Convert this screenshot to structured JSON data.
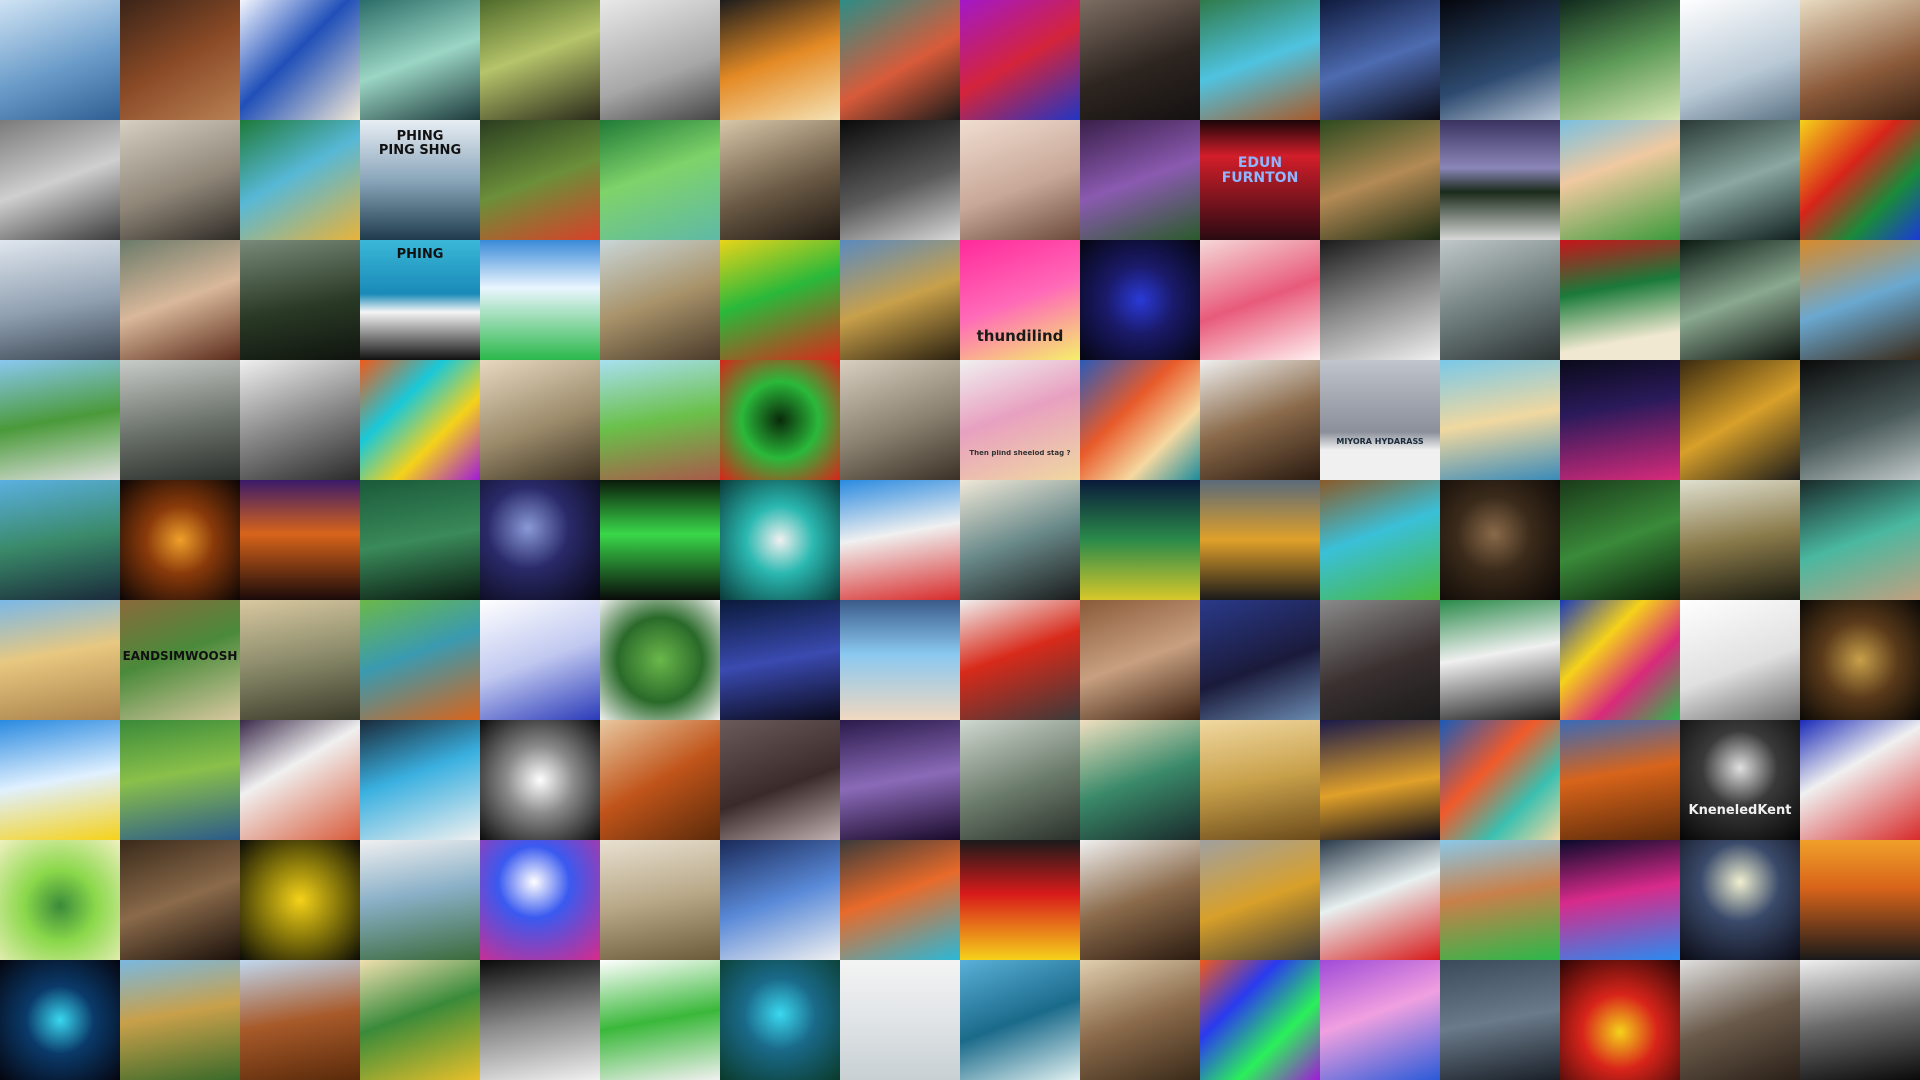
{
  "mosaic": {
    "tiles": [
      {
        "name": "tile-ice-figure",
        "bg": "linear-gradient(160deg,#cfe3f4 0%,#6b9cc9 55%,#2f5f93 100%)"
      },
      {
        "name": "tile-cello-forest",
        "bg": "linear-gradient(150deg,#3b2418 0%,#8a4a26 50%,#b98054 100%)"
      },
      {
        "name": "tile-wave-binoculars",
        "bg": "linear-gradient(135deg,#f3f6ff 0%,#1f4fb8 45%,#f2e9d6 100%)"
      },
      {
        "name": "tile-robot-city",
        "bg": "linear-gradient(160deg,#2b6d68 0%,#9bd6c4 50%,#1d3a3b 100%)"
      },
      {
        "name": "tile-man-forest",
        "bg": "linear-gradient(160deg,#4e6a2a 0%,#b6c46a 45%,#2a2a1a 100%)"
      },
      {
        "name": "tile-sink-drain",
        "bg": "linear-gradient(160deg,#e9e9e9 0%,#a7a7a7 60%,#444 100%)"
      },
      {
        "name": "tile-volcano-glasses",
        "bg": "linear-gradient(160deg,#1c1c1c 0%,#e48a25 50%,#f4e1b3 100%)"
      },
      {
        "name": "tile-dragon-mural",
        "bg": "linear-gradient(150deg,#2c8d86 0%,#d85b3a 55%,#1a1a1a 100%)"
      },
      {
        "name": "tile-vampire-neon",
        "bg": "linear-gradient(150deg,#a218c9 0%,#d4243b 50%,#2135c3 100%)"
      },
      {
        "name": "tile-woman-portrait",
        "bg": "linear-gradient(160deg,#7d6d62 0%,#2d2520 55%,#151111 100%)"
      },
      {
        "name": "tile-waterfall-boat",
        "bg": "linear-gradient(160deg,#2f7a4a 0%,#4fc3e0 50%,#a85a2a 100%)"
      },
      {
        "name": "tile-werewolf-city",
        "bg": "linear-gradient(160deg,#0f1a3d 0%,#4d6bb0 50%,#0a0a14 100%)"
      },
      {
        "name": "tile-satellite-earth",
        "bg": "linear-gradient(160deg,#05060d 0%,#2d4a6f 60%,#b8c6d6 100%)"
      },
      {
        "name": "tile-forest-path",
        "bg": "linear-gradient(160deg,#10291c 0%,#5d9a57 50%,#d7e6b3 100%)"
      },
      {
        "name": "tile-telescope-white",
        "bg": "linear-gradient(160deg,#ffffff 0%,#b9c9d6 60%,#5b7385 100%)"
      },
      {
        "name": "tile-scissors-desert",
        "bg": "linear-gradient(160deg,#e9dcc2 0%,#8b5a3a 60%,#3b2315 100%)"
      },
      {
        "name": "tile-snow-sculpture",
        "bg": "linear-gradient(160deg,#7a7a7a 0%,#cfcfcf 50%,#3b3b3b 100%)"
      },
      {
        "name": "tile-deer-sepia",
        "bg": "linear-gradient(160deg,#d6cfc2 0%,#8f8678 55%,#2e2a25 100%)"
      },
      {
        "name": "tile-irish-man",
        "bg": "linear-gradient(150deg,#1e7a3a 0%,#57b8d6 45%,#e8b33a 100%)"
      },
      {
        "name": "tile-ping-pong",
        "bg": "linear-gradient(180deg,#e8eef4 0%,#8aa6ba 50%,#1f3b4d 100%)",
        "caption": "PHING\nPING SHNG",
        "capColor": "#111",
        "capTop": 10,
        "capSize": 13
      },
      {
        "name": "tile-origami-tripod",
        "bg": "linear-gradient(160deg,#2a3d20 0%,#6b8f3a 50%,#d8412a 100%)"
      },
      {
        "name": "tile-green-statue",
        "bg": "linear-gradient(160deg,#1f7a36 0%,#7fd36a 45%,#5fb9a6 100%)"
      },
      {
        "name": "tile-sepia-warrior",
        "bg": "linear-gradient(160deg,#d8c7a8 0%,#6b5a45 55%,#1e1812 100%)"
      },
      {
        "name": "tile-chess-tree",
        "bg": "linear-gradient(160deg,#0a0a0a 0%,#5a5a5a 55%,#d9d9d9 100%)"
      },
      {
        "name": "tile-skateboard",
        "bg": "linear-gradient(160deg,#f0ddd0 0%,#c8a898 55%,#6b4a3a 100%)"
      },
      {
        "name": "tile-fairy-forest",
        "bg": "linear-gradient(160deg,#3a1f4a 0%,#8a5ab0 50%,#2a5a2a 100%)"
      },
      {
        "name": "tile-edun-furnton",
        "bg": "linear-gradient(180deg,#1a0508 0%,#d21e2a 30%,#2a0a12 100%)",
        "caption": "EDUN\nFURNTON",
        "capColor": "#8fb6ff",
        "capTop": 36,
        "capSize": 14
      },
      {
        "name": "tile-couple-jungle",
        "bg": "linear-gradient(160deg,#2d4a1f 0%,#b38a55 50%,#1a2a12 100%)"
      },
      {
        "name": "tile-checker-lake",
        "bg": "linear-gradient(180deg,#3a3360 0%,#8b86b8 40%,#1a2a1a 60%,#d8d8d8 100%)"
      },
      {
        "name": "tile-green-figure",
        "bg": "linear-gradient(160deg,#7ac0e0 0%,#f0c9a0 40%,#3a9a3a 100%)"
      },
      {
        "name": "tile-stone-hall",
        "bg": "linear-gradient(160deg,#2a3a36 0%,#8aa7a0 50%,#10201e 100%)"
      },
      {
        "name": "tile-graffiti-cross",
        "bg": "linear-gradient(135deg,#f5d21a 0%,#d8241a 40%,#1a8a3a 70%,#1a3ad8 100%)"
      },
      {
        "name": "tile-sky-clouds",
        "bg": "linear-gradient(170deg,#dfe6ee 0%,#8f9fb0 55%,#3a4652 100%)"
      },
      {
        "name": "tile-woman-profile",
        "bg": "linear-gradient(160deg,#6b7a6a 0%,#d9b89a 50%,#5a2a1a 100%)"
      },
      {
        "name": "tile-dark-forest",
        "bg": "linear-gradient(170deg,#7a8a7a 0%,#2a3a26 55%,#0f140e 100%)"
      },
      {
        "name": "tile-phing-board",
        "bg": "linear-gradient(180deg,#3ab8d8 0%,#1a8ab8 45%,#f5f5f5 60%,#111 100%)",
        "caption": "PHING",
        "capColor": "#111",
        "capTop": 8,
        "capSize": 13
      },
      {
        "name": "tile-gamepad",
        "bg": "linear-gradient(180deg,#3a8ad8 0%,#eaf6ff 40%,#2ab84a 100%)"
      },
      {
        "name": "tile-dry-grass",
        "bg": "linear-gradient(160deg,#c9d6d8 0%,#a8936a 50%,#4a3a2a 100%)"
      },
      {
        "name": "tile-flower-field",
        "bg": "linear-gradient(160deg,#e8d41a 0%,#2ab83a 45%,#d82a1a 100%)"
      },
      {
        "name": "tile-gold-sculpture",
        "bg": "linear-gradient(160deg,#5a8ac0 0%,#c8a04a 50%,#2a2010 100%)"
      },
      {
        "name": "tile-thundilind",
        "bg": "linear-gradient(160deg,#ff2a9a 0%,#ff6ab8 50%,#f5f06a 100%)",
        "caption": "thundilind",
        "capColor": "#1a1a1a",
        "capTop": 88,
        "capSize": 15
      },
      {
        "name": "tile-blue-vase",
        "bg": "radial-gradient(circle at 50% 50%,#2a3ad8 0%,#1a1a6a 40%,#050510 100%)"
      },
      {
        "name": "tile-geisha",
        "bg": "linear-gradient(160deg,#f5d8d8 0%,#e85a7a 50%,#fff0f0 100%)"
      },
      {
        "name": "tile-guitar",
        "bg": "linear-gradient(160deg,#1a1a1a 0%,#8a8a8a 50%,#f0f0f0 100%)"
      },
      {
        "name": "tile-waterfall-man",
        "bg": "linear-gradient(160deg,#c0c8c8 0%,#6a7878 55%,#2a3030 100%)"
      },
      {
        "name": "tile-green-poster",
        "bg": "linear-gradient(170deg,#c8141a 0%,#1a7a3a 40%,#f0e8d0 80%)"
      },
      {
        "name": "tile-dark-columns",
        "bg": "linear-gradient(160deg,#0a1a12 0%,#8aa890 50%,#0a0f0a 100%)"
      },
      {
        "name": "tile-gold-face",
        "bg": "linear-gradient(160deg,#d88a2a 0%,#6aa8d0 50%,#3a2a1a 100%)"
      },
      {
        "name": "tile-robot-road",
        "bg": "linear-gradient(170deg,#8ac8f0 0%,#4a9a3a 50%,#e0e0e0 100%)"
      },
      {
        "name": "tile-foggy-trees",
        "bg": "linear-gradient(170deg,#c8ccc8 0%,#6a706a 55%,#2a2e2a 100%)"
      },
      {
        "name": "tile-sand-climber",
        "bg": "linear-gradient(160deg,#f0f0f0 0%,#8a8a8a 50%,#2a2a2a 100%)"
      },
      {
        "name": "tile-roller-blocks",
        "bg": "linear-gradient(135deg,#f05a1a 0%,#1ac8d8 35%,#f5d21a 65%,#a01ad8 100%)"
      },
      {
        "name": "tile-sepia-man",
        "bg": "linear-gradient(160deg,#e8d8c0 0%,#9a8a6a 55%,#3a3020 100%)"
      },
      {
        "name": "tile-floating-island",
        "bg": "linear-gradient(170deg,#a8e0f0 0%,#6ac04a 50%,#a85a4a 100%)"
      },
      {
        "name": "tile-clock-plants",
        "bg": "radial-gradient(circle at 50% 50%,#0a2a0a 0%,#2ab83a 45%,#d8241a 100%)"
      },
      {
        "name": "tile-smoke-face",
        "bg": "linear-gradient(160deg,#d8cfc0 0%,#8a8070 55%,#3a3025 100%)"
      },
      {
        "name": "tile-polaroid",
        "bg": "linear-gradient(160deg,#f0f0f0 0%,#e8a0c0 45%,#f0d8a0 100%)",
        "caption": "Then plind sheelod stag ?",
        "capColor": "#333",
        "capTop": 90,
        "capSize": 7
      },
      {
        "name": "tile-dragon-pattern",
        "bg": "linear-gradient(135deg,#2a5ab8 0%,#e85a2a 40%,#f5d8a0 70%,#1a8a9a 100%)"
      },
      {
        "name": "tile-man-hat",
        "bg": "linear-gradient(160deg,#f0f0f0 0%,#8a6a4a 50%,#2a1a10 100%)"
      },
      {
        "name": "tile-miyora-hydarass",
        "bg": "linear-gradient(180deg,#c0c4cc 0%,#8a8f9a 60%,#f0f0f0 75%,#f0f0f0 100%)",
        "caption": "MIYORA HYDARASS",
        "capColor": "#1a2a3a",
        "capTop": 78,
        "capSize": 8
      },
      {
        "name": "tile-beach-robot",
        "bg": "linear-gradient(170deg,#7ac8e8 0%,#f0d8a0 50%,#3a8ab8 100%)"
      },
      {
        "name": "tile-neon-books",
        "bg": "linear-gradient(170deg,#0a0a1a 0%,#2a1a5a 40%,#d82a7a 100%)"
      },
      {
        "name": "tile-gold-bird",
        "bg": "linear-gradient(150deg,#3a2a10 0%,#d8a02a 50%,#1a1a1a 100%)"
      },
      {
        "name": "tile-dark-reader",
        "bg": "linear-gradient(160deg,#0a0a0a 0%,#4a5a5a 55%,#c0c8c8 100%)"
      },
      {
        "name": "tile-telescope-lake",
        "bg": "linear-gradient(170deg,#5ab0e0 0%,#3a8a6a 50%,#1a2a3a 100%)"
      },
      {
        "name": "tile-fire-dancer",
        "bg": "radial-gradient(circle at 50% 50%,#f0a02a 0%,#8a3a0a 40%,#0a0505 100%)"
      },
      {
        "name": "tile-sunset-field",
        "bg": "linear-gradient(180deg,#3a1a6a 0%,#d8641a 45%,#1a0a0a 100%)"
      },
      {
        "name": "tile-roller-skate",
        "bg": "linear-gradient(170deg,#1a5a3a 0%,#3a8a5a 50%,#0a1a10 100%)"
      },
      {
        "name": "tile-galaxy",
        "bg": "radial-gradient(circle at 40% 40%,#8a9ad8 0%,#2a2a6a 40%,#05050f 100%)"
      },
      {
        "name": "tile-piano-light",
        "bg": "linear-gradient(180deg,#0a1a0a 0%,#3ad84a 45%,#0a0a0a 100%)"
      },
      {
        "name": "tile-fan-wave",
        "bg": "radial-gradient(circle at 50% 50%,#f0f0f0 0%,#2ab8b0 40%,#0a3a3a 100%)"
      },
      {
        "name": "tile-graffiti-tower",
        "bg": "linear-gradient(170deg,#2a8ae0 0%,#f0f0f0 45%,#d82a2a 100%)"
      },
      {
        "name": "tile-thinker-art",
        "bg": "linear-gradient(160deg,#f0e8d8 0%,#6a8a8a 50%,#1a1a1a 100%)"
      },
      {
        "name": "tile-neon-forest",
        "bg": "linear-gradient(180deg,#0a1a3a 0%,#2a8a4a 50%,#d8c82a 100%)"
      },
      {
        "name": "tile-city-clock",
        "bg": "linear-gradient(180deg,#5a6a7a 0%,#e0a02a 50%,#1a1a1a 100%)"
      },
      {
        "name": "tile-pixel-map",
        "bg": "linear-gradient(160deg,#8a5a2a 0%,#3ac0d8 45%,#4ab83a 100%)"
      },
      {
        "name": "tile-dark-cave",
        "bg": "radial-gradient(circle at 45% 45%,#8a6a4a 0%,#3a2a1a 40%,#0a0605 100%)"
      },
      {
        "name": "tile-green-demon",
        "bg": "linear-gradient(160deg,#1a3a1a 0%,#3a8a3a 50%,#0a1a0a 100%)"
      },
      {
        "name": "tile-pixel-tower",
        "bg": "linear-gradient(170deg,#e0e0d0 0%,#8a7a4a 50%,#1a1a10 100%)"
      },
      {
        "name": "tile-green-creature",
        "bg": "linear-gradient(160deg,#1a2a2a 0%,#4ab8a0 50%,#c0a080 100%)"
      },
      {
        "name": "tile-desert-robot",
        "bg": "linear-gradient(170deg,#7ab8e8 0%,#e8c880 45%,#a8804a 100%)"
      },
      {
        "name": "tile-eandsimwoosh",
        "bg": "linear-gradient(160deg,#8a6a3a 0%,#4a8a3a 45%,#d8c8a0 100%)",
        "caption": "EANDSIMWOOSH",
        "capColor": "#111",
        "capTop": 50,
        "capSize": 12
      },
      {
        "name": "tile-road-fence",
        "bg": "linear-gradient(170deg,#d8c8a0 0%,#8a8a6a 50%,#3a3a2a 100%)"
      },
      {
        "name": "tile-deer-river",
        "bg": "linear-gradient(160deg,#6ab84a 0%,#3a9ab0 45%,#d8641a 100%)"
      },
      {
        "name": "tile-blue-sketch",
        "bg": "linear-gradient(160deg,#ffffff 0%,#c0c8f0 50%,#2a3ab8 100%)"
      },
      {
        "name": "tile-leaf-tree",
        "bg": "radial-gradient(circle at 50% 50%,#6ab84a 0%,#2a6a2a 50%,#f0f0f0 100%)"
      },
      {
        "name": "tile-blue-jungle",
        "bg": "linear-gradient(170deg,#0a1a3a 0%,#3a4ab0 50%,#0a0a1a 100%)"
      },
      {
        "name": "tile-crystal-tent",
        "bg": "linear-gradient(180deg,#3a5a8a 0%,#8ac8f0 45%,#f0d8c0 100%)"
      },
      {
        "name": "tile-mountain-warrior",
        "bg": "linear-gradient(160deg,#f0f0f0 0%,#d82a1a 45%,#3a3a3a 100%)"
      },
      {
        "name": "tile-vases-rocks",
        "bg": "linear-gradient(160deg,#8a5a3a 0%,#c8a080 50%,#3a2010 100%)"
      },
      {
        "name": "tile-blue-cave",
        "bg": "linear-gradient(160deg,#2a3a8a 0%,#1a1a3a 55%,#6a8ab0 100%)"
      },
      {
        "name": "tile-woman-lace",
        "bg": "linear-gradient(160deg,#8a8a8a 0%,#3a3030 55%,#1a1a1a 100%)"
      },
      {
        "name": "tile-skull-mask",
        "bg": "linear-gradient(170deg,#2a8a4a 0%,#f0f0f0 45%,#1a1a1a 100%)"
      },
      {
        "name": "tile-color-towers",
        "bg": "linear-gradient(135deg,#1a3ab8 0%,#f5d21a 35%,#d82a7a 65%,#2ab84a 100%)"
      },
      {
        "name": "tile-line-drawing",
        "bg": "linear-gradient(160deg,#ffffff 0%,#e0e0e0 55%,#6a6a6a 100%)"
      },
      {
        "name": "tile-circle-portal",
        "bg": "radial-gradient(circle at 50% 50%,#c8a04a 0%,#5a3a1a 45%,#0a0805 100%)"
      },
      {
        "name": "tile-phone-lighthouse",
        "bg": "linear-gradient(170deg,#2a8ae0 0%,#e0f0ff 50%,#f5d21a 100%)"
      },
      {
        "name": "tile-jungle-hammock",
        "bg": "linear-gradient(170deg,#3a8a3a 0%,#8ac04a 45%,#2a5a8a 100%)"
      },
      {
        "name": "tile-swirl-sleeper",
        "bg": "linear-gradient(150deg,#3a2a4a 0%,#f0f0f0 40%,#d85a3a 100%)"
      },
      {
        "name": "tile-waterfall-needle",
        "bg": "linear-gradient(160deg,#1a2a3a 0%,#3ab0e0 45%,#f0f0f0 100%)"
      },
      {
        "name": "tile-bw-compass",
        "bg": "radial-gradient(circle at 50% 50%,#ffffff 0%,#8a8a8a 40%,#0a0a0a 100%)"
      },
      {
        "name": "tile-phoenix-carving",
        "bg": "linear-gradient(150deg,#e8c8a0 0%,#c0541a 50%,#5a2a0a 100%)"
      },
      {
        "name": "tile-fan-engine",
        "bg": "linear-gradient(160deg,#6a5a5a 0%,#3a2a2a 55%,#c0b0b0 100%)"
      },
      {
        "name": "tile-purple-forest",
        "bg": "linear-gradient(170deg,#2a1a4a 0%,#8a6ab8 50%,#1a0a2a 100%)"
      },
      {
        "name": "tile-tea-machine",
        "bg": "linear-gradient(160deg,#d0d8d0 0%,#6a7a6a 55%,#2a302a 100%)"
      },
      {
        "name": "tile-ghoul-figure",
        "bg": "linear-gradient(160deg,#f0e0c0 0%,#3a8a6a 50%,#1a2a2a 100%)"
      },
      {
        "name": "tile-sand-dunes",
        "bg": "linear-gradient(170deg,#f0d8a0 0%,#c8a04a 50%,#6a4a1a 100%)"
      },
      {
        "name": "tile-night-window",
        "bg": "linear-gradient(170deg,#1a1a4a 0%,#e0a02a 55%,#0a0a1a 100%)"
      },
      {
        "name": "tile-dice-pattern",
        "bg": "linear-gradient(135deg,#1a5ab8 0%,#f05a2a 40%,#3ac0b0 70%,#f5d8a0 100%)"
      },
      {
        "name": "tile-dragon-desert",
        "bg": "linear-gradient(170deg,#3a6ab8 0%,#d8641a 45%,#5a2a0a 100%)"
      },
      {
        "name": "tile-kneneledkent",
        "bg": "radial-gradient(circle at 50% 40%,#e0e0e0 0%,#3a3a3a 40%,#050505 100%)",
        "caption": "KneneledKent",
        "capColor": "#f0f0f0",
        "capTop": 84,
        "capSize": 13
      },
      {
        "name": "tile-hotel-building",
        "bg": "linear-gradient(150deg,#1a2ab8 0%,#f0f0f0 40%,#d82a2a 100%)"
      },
      {
        "name": "tile-green-monster",
        "bg": "radial-gradient(circle at 50% 55%,#3a8a3a 0%,#8ad84a 40%,#f0f0c0 100%)"
      },
      {
        "name": "tile-cave-miner",
        "bg": "linear-gradient(160deg,#3a2a1a 0%,#8a6a4a 50%,#1a100a 100%)"
      },
      {
        "name": "tile-yellow-face",
        "bg": "radial-gradient(circle at 50% 50%,#f5d21a 0%,#8a7a0a 45%,#0a0a05 100%)"
      },
      {
        "name": "tile-palace-garden",
        "bg": "linear-gradient(170deg,#f0f0f0 0%,#8ab0c8 45%,#3a6a3a 100%)"
      },
      {
        "name": "tile-blue-burst",
        "bg": "radial-gradient(circle at 45% 35%,#ffffff 0%,#3a5af0 35%,#d82a8a 100%)"
      },
      {
        "name": "tile-pit-figure",
        "bg": "linear-gradient(170deg,#e8e0d0 0%,#b8a888 50%,#6a5a3a 100%)"
      },
      {
        "name": "tile-blue-eagle",
        "bg": "linear-gradient(160deg,#1a2a5a 0%,#5a8ad8 50%,#f0f0f0 100%)"
      },
      {
        "name": "tile-neon-stairs",
        "bg": "linear-gradient(160deg,#3a3a3a 0%,#e86a2a 45%,#2ab8d8 100%)"
      },
      {
        "name": "tile-lava-landscape",
        "bg": "linear-gradient(180deg,#1a1a1a 0%,#d81a1a 45%,#f5d21a 100%)"
      },
      {
        "name": "tile-milk-splash",
        "bg": "linear-gradient(160deg,#f0f0f0 0%,#8a6a4a 50%,#2a1a10 100%)"
      },
      {
        "name": "tile-snail-creature",
        "bg": "linear-gradient(160deg,#a0a0a0 0%,#d8a02a 50%,#3a3a3a 100%)"
      },
      {
        "name": "tile-bubble-button",
        "bg": "linear-gradient(160deg,#2a3a4a 0%,#e8f0f0 45%,#d81a1a 100%)"
      },
      {
        "name": "tile-rooftop-runner",
        "bg": "linear-gradient(170deg,#8ac8e8 0%,#c8804a 45%,#2ab84a 100%)"
      },
      {
        "name": "tile-neon-alley",
        "bg": "linear-gradient(170deg,#0a0a2a 0%,#d82a8a 45%,#2a8af0 100%)"
      },
      {
        "name": "tile-moon-fox",
        "bg": "radial-gradient(circle at 50% 35%,#f0f0d0 0%,#3a4a6a 40%,#0a0a14 100%)"
      },
      {
        "name": "tile-sunset-lake",
        "bg": "linear-gradient(180deg,#f0a02a 0%,#d8641a 40%,#1a1a1a 100%)"
      },
      {
        "name": "tile-neon-gargoyle",
        "bg": "radial-gradient(circle at 50% 50%,#3ad8f0 0%,#0a3a6a 40%,#05050f 100%)"
      },
      {
        "name": "tile-painted-hills",
        "bg": "linear-gradient(170deg,#7ab8e0 0%,#c8a04a 45%,#3a6a2a 100%)"
      },
      {
        "name": "tile-clay-peak",
        "bg": "linear-gradient(170deg,#c0d8f0 0%,#a85a2a 50%,#5a2a0a 100%)"
      },
      {
        "name": "tile-viking-cartoon",
        "bg": "linear-gradient(160deg,#f0e0b0 0%,#3a8a3a 45%,#e8c02a 100%)"
      },
      {
        "name": "tile-bw-crowd",
        "bg": "linear-gradient(170deg,#0a0a0a 0%,#8a8a8a 50%,#f0f0f0 100%)"
      },
      {
        "name": "tile-green-hiker",
        "bg": "linear-gradient(170deg,#ffffff 0%,#3ab83a 50%,#f0f0f0 100%)"
      },
      {
        "name": "tile-blue-flower",
        "bg": "radial-gradient(circle at 50% 45%,#3ad8f0 0%,#1a6a8a 40%,#0a3a2a 100%)"
      },
      {
        "name": "tile-minimal-sea",
        "bg": "linear-gradient(180deg,#f4f4f4 0%,#e0e4e6 50%,#c8d0d4 100%)"
      },
      {
        "name": "tile-surf-cliff",
        "bg": "linear-gradient(160deg,#5ab0d8 0%,#1a6a8a 50%,#e0f0f0 100%)"
      },
      {
        "name": "tile-steampunk-car",
        "bg": "linear-gradient(160deg,#e0d0b0 0%,#8a6a4a 50%,#3a2a1a 100%)"
      },
      {
        "name": "tile-pop-art-faces",
        "bg": "linear-gradient(135deg,#f05a1a 0%,#2a3af0 33%,#2af05a 66%,#a01ad8 100%)"
      },
      {
        "name": "tile-purple-surf",
        "bg": "linear-gradient(160deg,#a04ad8 0%,#f0a0e0 45%,#2a5ad8 100%)"
      },
      {
        "name": "tile-hangar-soldier",
        "bg": "linear-gradient(170deg,#3a4a5a 0%,#6a7a8a 50%,#1a2028 100%)"
      },
      {
        "name": "tile-fire-clock",
        "bg": "radial-gradient(circle at 50% 60%,#f5d21a 0%,#d8241a 40%,#2a0505 100%)"
      },
      {
        "name": "tile-cat-statue",
        "bg": "linear-gradient(160deg,#e0e0e0 0%,#6a5a4a 50%,#2a2018 100%)"
      },
      {
        "name": "tile-wolf-forest",
        "bg": "linear-gradient(170deg,#f0f0f0 0%,#6a6a6a 50%,#0a0a0a 100%)"
      }
    ]
  }
}
